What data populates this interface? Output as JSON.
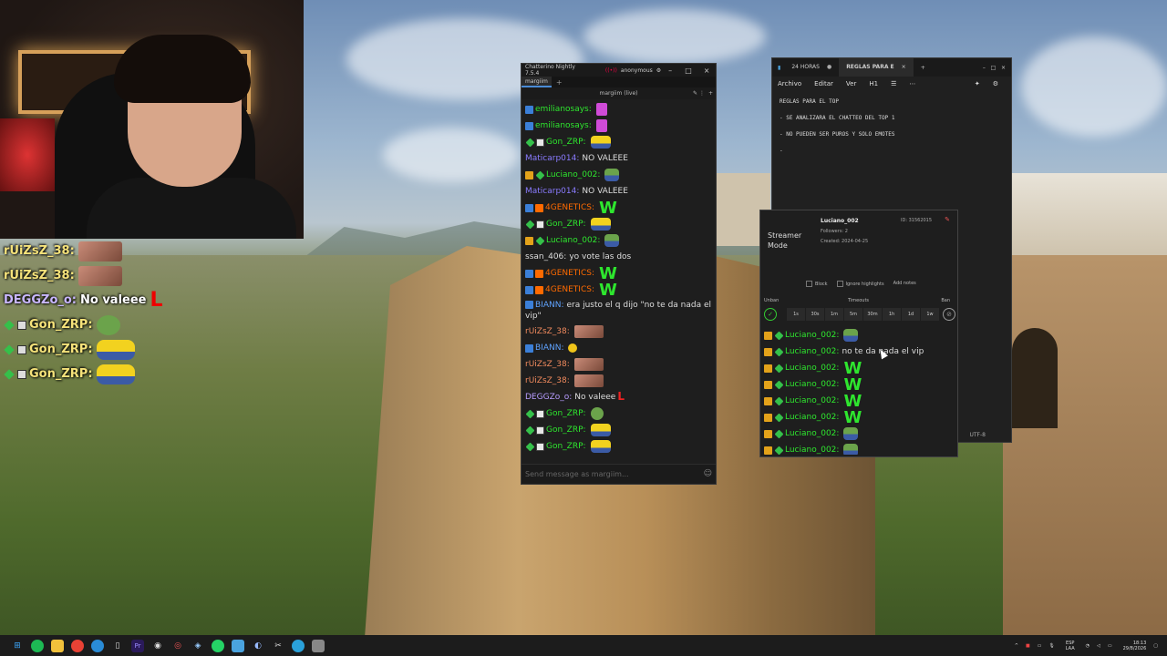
{
  "overlay_chat": [
    {
      "user": "rUiZsZ_38:",
      "text": "",
      "emote": "face"
    },
    {
      "user": "rUiZsZ_38:",
      "text": "",
      "emote": "face"
    },
    {
      "user": "DEGGZo_o:",
      "text": "No valeee",
      "emote": "L"
    },
    {
      "user": "Gon_ZRP:",
      "text": "",
      "emote": "pepe"
    },
    {
      "user": "Gon_ZRP:",
      "text": "",
      "emote": "minion"
    },
    {
      "user": "Gon_ZRP:",
      "text": "",
      "emote": "minion"
    }
  ],
  "chatterino": {
    "title": "Chatterino Nightly 7.5.4",
    "account": "anonymous",
    "tab": "margiim",
    "channel_header": "margiim (live)",
    "input_placeholder": "Send message as margiim...",
    "messages": [
      {
        "user": "emilianosays:",
        "color": "#2ee62e",
        "badges": [
          "blue"
        ],
        "text": "",
        "emotes": [
          "pink"
        ]
      },
      {
        "user": "emilianosays:",
        "color": "#2ee62e",
        "badges": [
          "blue"
        ],
        "text": "",
        "emotes": [
          "pink"
        ]
      },
      {
        "user": "Gon_ZRP:",
        "color": "#2ee62e",
        "badges": [
          "green",
          "box"
        ],
        "text": "",
        "emotes": [
          "minion"
        ]
      },
      {
        "user": "Maticarp014:",
        "color": "#8a7bff",
        "badges": [],
        "text": "NO VALEEE",
        "emotes": []
      },
      {
        "user": "Luciano_002:",
        "color": "#2ee62e",
        "badges": [
          "gold",
          "green"
        ],
        "text": "",
        "emotes": [
          "pepe2"
        ]
      },
      {
        "user": "Maticarp014:",
        "color": "#8a7bff",
        "badges": [],
        "text": "NO VALEEE",
        "emotes": []
      },
      {
        "user": "4GENETICS:",
        "color": "#ff6a00",
        "badges": [
          "blue",
          "orange"
        ],
        "text": "",
        "emotes": [
          "W"
        ]
      },
      {
        "user": "Gon_ZRP:",
        "color": "#2ee62e",
        "badges": [
          "green",
          "box"
        ],
        "text": "",
        "emotes": [
          "minion"
        ]
      },
      {
        "user": "Luciano_002:",
        "color": "#2ee62e",
        "badges": [
          "gold",
          "green"
        ],
        "text": "",
        "emotes": [
          "pepe2"
        ]
      },
      {
        "user": "ssan_406:",
        "color": "#dddddd",
        "badges": [],
        "text": "yo vote las dos",
        "emotes": []
      },
      {
        "user": "4GENETICS:",
        "color": "#ff6a00",
        "badges": [
          "blue",
          "orange"
        ],
        "text": "",
        "emotes": [
          "W"
        ]
      },
      {
        "user": "4GENETICS:",
        "color": "#ff6a00",
        "badges": [
          "blue",
          "orange"
        ],
        "text": "",
        "emotes": [
          "W"
        ]
      },
      {
        "user": "BIANN:",
        "color": "#5fa3ff",
        "badges": [
          "blue"
        ],
        "text": "era justo el q dijo \"no te da nada el vip\"",
        "emotes": [],
        "wrap": true
      },
      {
        "user": "rUiZsZ_38:",
        "color": "#f08a5d",
        "badges": [],
        "text": "",
        "emotes": [
          "face"
        ]
      },
      {
        "user": "BIANN:",
        "color": "#5fa3ff",
        "badges": [
          "blue"
        ],
        "text": "",
        "emotes": [
          "smile"
        ]
      },
      {
        "user": "rUiZsZ_38:",
        "color": "#f08a5d",
        "badges": [],
        "text": "",
        "emotes": [
          "face"
        ]
      },
      {
        "user": "rUiZsZ_38:",
        "color": "#f08a5d",
        "badges": [],
        "text": "",
        "emotes": [
          "face"
        ]
      },
      {
        "user": "DEGGZo_o:",
        "color": "#b79cff",
        "badges": [],
        "text": "No valeee",
        "emotes": [
          "L"
        ]
      },
      {
        "user": "Gon_ZRP:",
        "color": "#2ee62e",
        "badges": [
          "green",
          "box"
        ],
        "text": "",
        "emotes": [
          "pepe"
        ]
      },
      {
        "user": "Gon_ZRP:",
        "color": "#2ee62e",
        "badges": [
          "green",
          "box"
        ],
        "text": "",
        "emotes": [
          "minion"
        ]
      },
      {
        "user": "Gon_ZRP:",
        "color": "#2ee62e",
        "badges": [
          "green",
          "box"
        ],
        "text": "",
        "emotes": [
          "minion"
        ]
      }
    ]
  },
  "notepad": {
    "tabs": [
      "24 HORAS",
      "REGLAS PARA E"
    ],
    "menu": [
      "Archivo",
      "Editar",
      "Ver"
    ],
    "heading_menu": "H1",
    "lines": [
      "REGLAS PARA EL TOP",
      "- SE ANALIZARA EL CHATTEO DEL TOP 1",
      "- NO PUEDEN SER PUROS Y SOLO EMOTES",
      "-"
    ],
    "status": "UTF-8"
  },
  "user_popup": {
    "mode": "Streamer Mode",
    "username": "Luciano_002",
    "id": "ID: 31562015",
    "followers": "Followers: 2",
    "created": "Created: 2024-04-25",
    "actions": [
      "Block",
      "Ignore highlights",
      "Add notes"
    ],
    "unban_label": "Unban",
    "timeouts_label": "Timeouts",
    "ban_label": "Ban",
    "timeouts": [
      "1s",
      "30s",
      "1m",
      "5m",
      "30m",
      "1h",
      "1d",
      "1w"
    ],
    "messages": [
      {
        "user": "Luciano_002:",
        "text": "",
        "emote": "pepe2"
      },
      {
        "user": "Luciano_002:",
        "text": "no te da nada el vip",
        "emote": ""
      },
      {
        "user": "Luciano_002:",
        "text": "",
        "emote": "W"
      },
      {
        "user": "Luciano_002:",
        "text": "",
        "emote": "W"
      },
      {
        "user": "Luciano_002:",
        "text": "",
        "emote": "W"
      },
      {
        "user": "Luciano_002:",
        "text": "",
        "emote": "W"
      },
      {
        "user": "Luciano_002:",
        "text": "",
        "emote": "pepe2"
      },
      {
        "user": "Luciano_002:",
        "text": "",
        "emote": "pepe2"
      }
    ]
  },
  "taskbar": {
    "lang_top": "ESP",
    "lang_bottom": "LAA",
    "time": "18:13",
    "date": "29/8/2026"
  }
}
